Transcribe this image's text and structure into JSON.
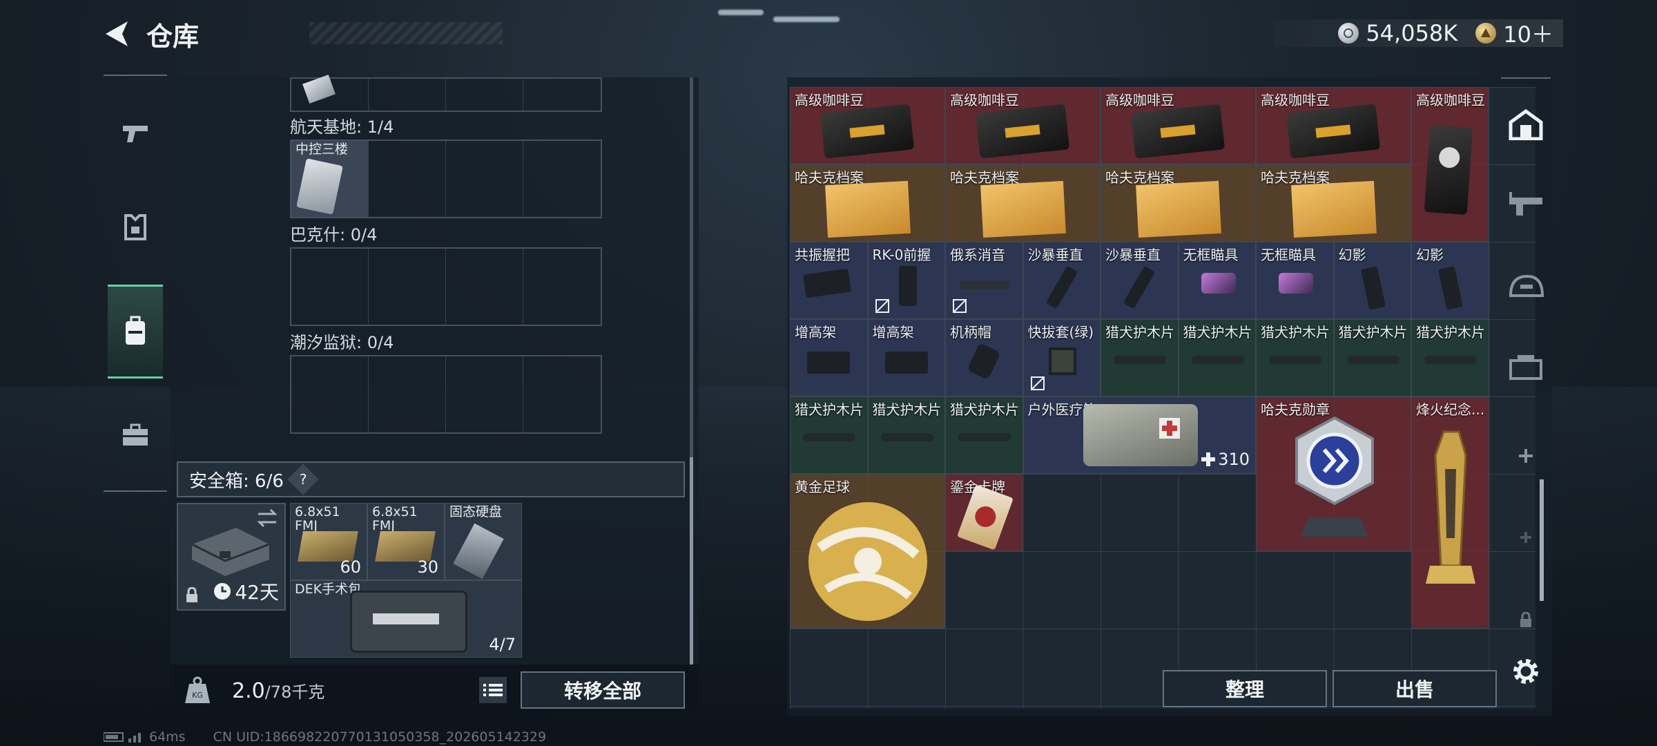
{
  "header": {
    "title": "仓库"
  },
  "currency": {
    "coins": "54,058K",
    "tickets": "10＋"
  },
  "left": {
    "sections": [
      {
        "label": "航天基地: 1/4",
        "slot_label": "中控三楼"
      },
      {
        "label": "巴克什: 0/4"
      },
      {
        "label": "潮汐监狱: 0/4"
      }
    ],
    "safe": {
      "title": "安全箱: 6/6",
      "help": "?",
      "days": "42天",
      "items": [
        {
          "label": "6.8x51 FMJ",
          "qty": "60"
        },
        {
          "label": "6.8x51 FMJ",
          "qty": "30"
        },
        {
          "label": "固态硬盘",
          "qty": ""
        },
        {
          "label": "DEK手术包",
          "qty": "4/7"
        }
      ]
    },
    "weight": {
      "current": "2.0",
      "max": "/78千克"
    },
    "transfer_label": "转移全部"
  },
  "inventory": {
    "items": [
      {
        "label": "高级咖啡豆",
        "qty": ""
      },
      {
        "label": "高级咖啡豆",
        "qty": ""
      },
      {
        "label": "高级咖啡豆",
        "qty": ""
      },
      {
        "label": "高级咖啡豆",
        "qty": ""
      },
      {
        "label": "高级咖啡豆",
        "qty": ""
      },
      {
        "label": "哈夫克档案",
        "qty": ""
      },
      {
        "label": "哈夫克档案",
        "qty": ""
      },
      {
        "label": "哈夫克档案",
        "qty": ""
      },
      {
        "label": "哈夫克档案",
        "qty": ""
      },
      {
        "label": "共振握把",
        "qty": ""
      },
      {
        "label": "RK-0前握",
        "qty": ""
      },
      {
        "label": "俄系消音",
        "qty": ""
      },
      {
        "label": "沙暴垂直",
        "qty": ""
      },
      {
        "label": "沙暴垂直",
        "qty": ""
      },
      {
        "label": "无框瞄具",
        "qty": ""
      },
      {
        "label": "无框瞄具",
        "qty": ""
      },
      {
        "label": "幻影",
        "qty": ""
      },
      {
        "label": "幻影",
        "qty": ""
      },
      {
        "label": "增高架",
        "qty": ""
      },
      {
        "label": "增高架",
        "qty": ""
      },
      {
        "label": "机柄帽",
        "qty": ""
      },
      {
        "label": "快拔套(绿)",
        "qty": ""
      },
      {
        "label": "猎犬护木片",
        "qty": ""
      },
      {
        "label": "猎犬护木片",
        "qty": ""
      },
      {
        "label": "猎犬护木片",
        "qty": ""
      },
      {
        "label": "猎犬护木片",
        "qty": ""
      },
      {
        "label": "猎犬护木片",
        "qty": ""
      },
      {
        "label": "猎犬护木片",
        "qty": ""
      },
      {
        "label": "猎犬护木片",
        "qty": ""
      },
      {
        "label": "猎犬护木片",
        "qty": ""
      },
      {
        "label": "户外医疗箱",
        "qty": "310"
      },
      {
        "label": "哈夫克勋章",
        "qty": ""
      },
      {
        "label": "烽火纪念...",
        "qty": ""
      },
      {
        "label": "黄金足球",
        "qty": ""
      },
      {
        "label": "鎏金卡牌",
        "qty": ""
      }
    ],
    "sort_label": "整理",
    "sell_label": "出售"
  },
  "footer": {
    "ping": "64ms",
    "uid": "CN UID:1866982207701310503​58_202605142329"
  }
}
